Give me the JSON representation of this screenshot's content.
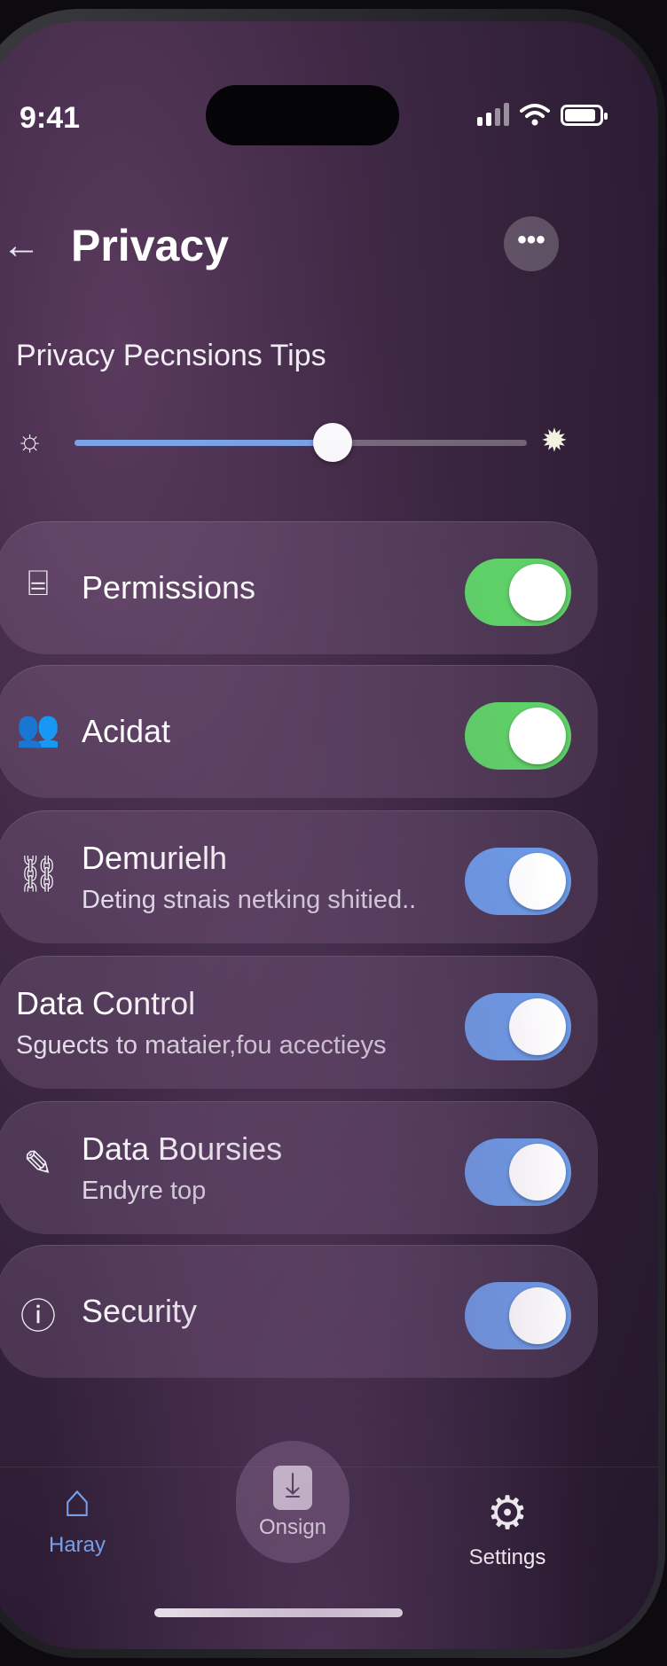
{
  "status_bar": {
    "time": "9:41"
  },
  "header": {
    "back_icon": "arrow-left-icon",
    "title": "Privacy",
    "more_icon": "ellipsis-icon",
    "more_label": "•••"
  },
  "section": {
    "title": "Privacy Pecnsions Tips"
  },
  "slider": {
    "left_icon": "brightness-low-icon",
    "right_icon": "brightness-high-icon",
    "value_fraction": 0.57,
    "fill_color": "#7aa3e8"
  },
  "settings": [
    {
      "icon": "permissions-icon",
      "icon_glyph": "⌸",
      "label": "Permissions",
      "sub": "",
      "toggle_on": true,
      "toggle_color": "#5fd068"
    },
    {
      "icon": "people-icon",
      "icon_glyph": "👥",
      "label": "Acidat",
      "sub": "",
      "toggle_on": true,
      "toggle_color": "#5fd068"
    },
    {
      "icon": "tag-icon",
      "icon_glyph": "⛓",
      "label": "Demurielh",
      "sub": "Deting stnais netking shitied..",
      "toggle_on": true,
      "toggle_color": "#6c9ae6"
    },
    {
      "icon": "",
      "icon_glyph": "",
      "label": "Data Control",
      "sub": "Sguects to mataier,fou acectieys",
      "toggle_on": true,
      "toggle_color": "#6c9ae6"
    },
    {
      "icon": "edit-note-icon",
      "icon_glyph": "✎",
      "label": "Data Boursies",
      "sub": "Endyre top",
      "toggle_on": true,
      "toggle_color": "#6c9ae6"
    },
    {
      "icon": "alert-circle-icon",
      "icon_glyph": "ⓘ",
      "label": "Security",
      "sub": "",
      "toggle_on": true,
      "toggle_color": "#6c9ae6"
    }
  ],
  "tab_bar": {
    "home": {
      "icon": "home-icon",
      "label": "Haray"
    },
    "center": {
      "icon": "download-icon",
      "label": "Onsign"
    },
    "settings": {
      "icon": "gear-icon",
      "label": "Settings"
    }
  }
}
